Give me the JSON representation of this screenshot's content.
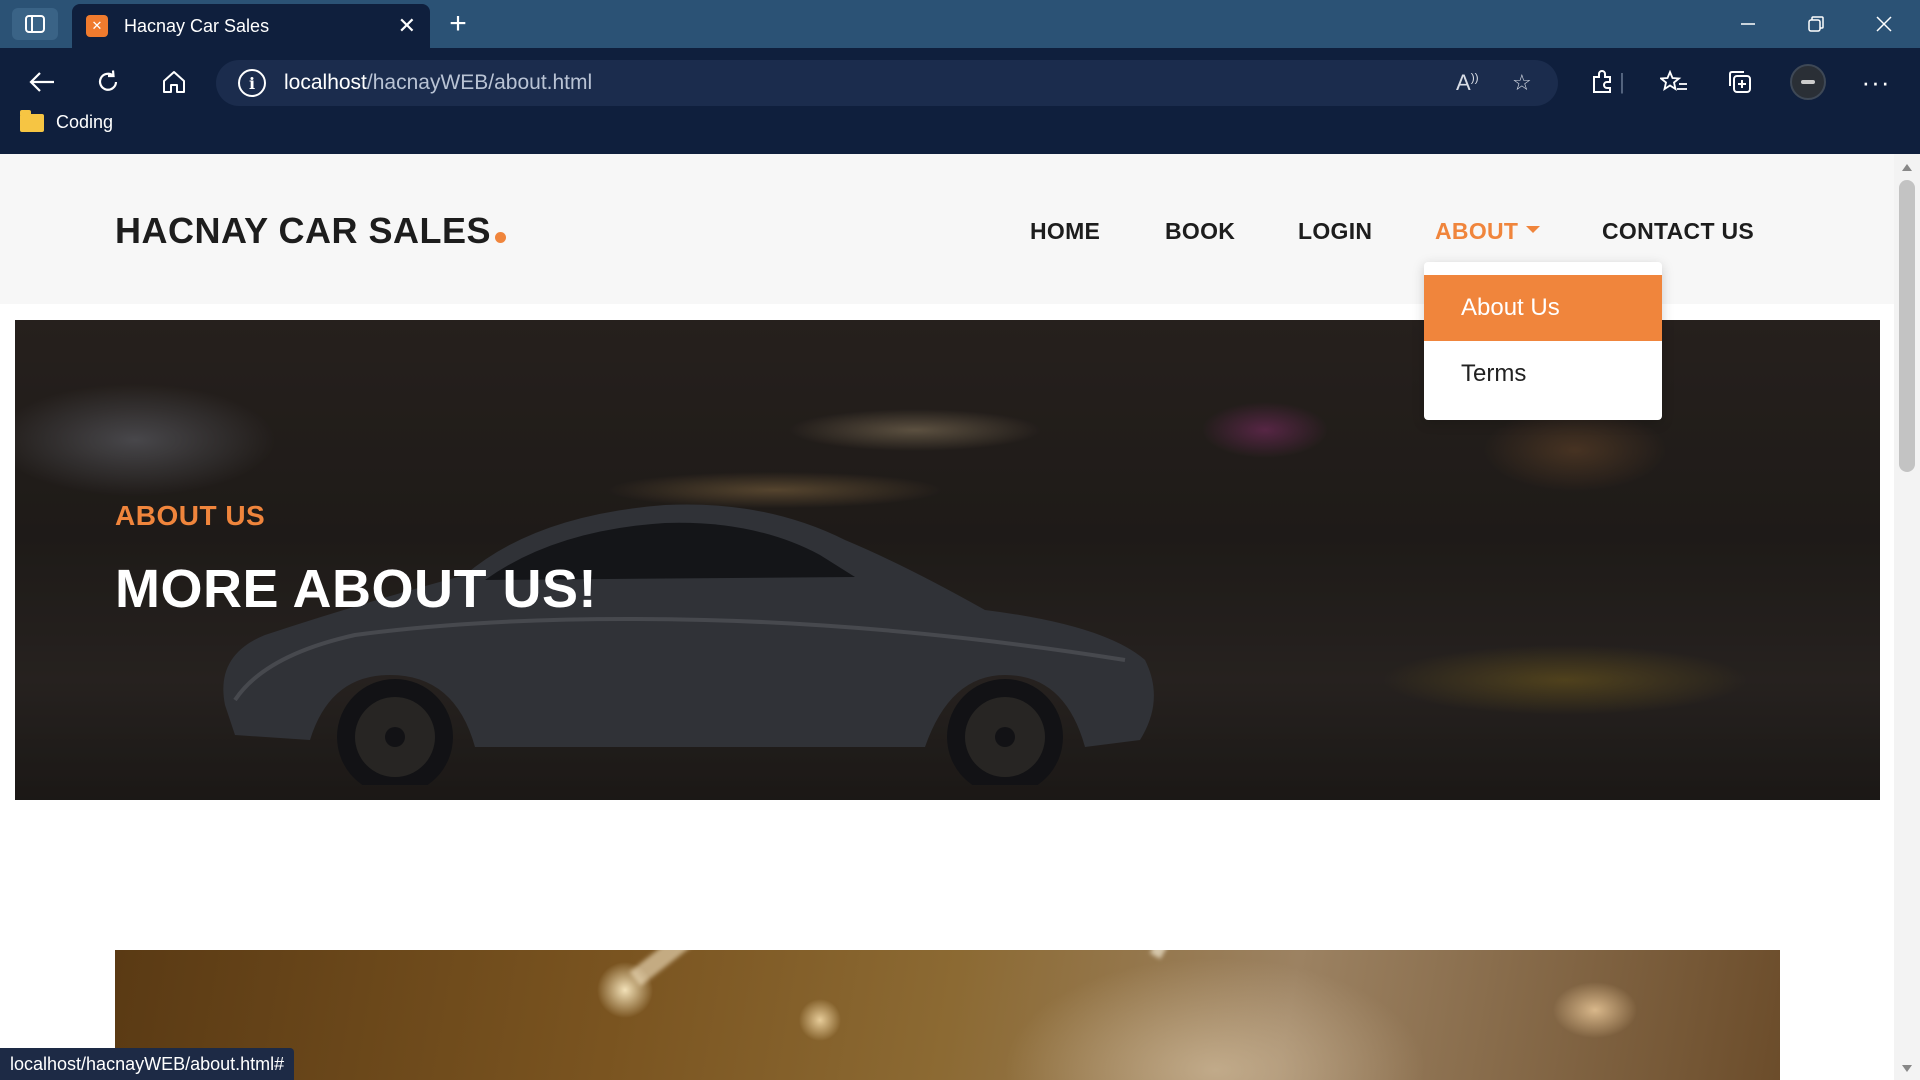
{
  "browser": {
    "tab": {
      "favicon": "XAMPP",
      "title": "Hacnay Car Sales"
    },
    "address": {
      "host": "localhost",
      "path": "/hacnayWEB/about.html"
    },
    "bookmarks": [
      {
        "label": "Coding"
      }
    ],
    "status_url": "localhost/hacnayWEB/about.html#"
  },
  "site": {
    "brand": "HACNAY CAR SALES",
    "nav": [
      {
        "label": "HOME"
      },
      {
        "label": "BOOK"
      },
      {
        "label": "LOGIN"
      },
      {
        "label": "ABOUT"
      },
      {
        "label": "CONTACT US"
      }
    ],
    "dropdown": [
      {
        "label": "About Us",
        "active": true
      },
      {
        "label": "Terms",
        "active": false
      }
    ],
    "hero": {
      "subtitle": "ABOUT US",
      "title": "MORE ABOUT US!"
    }
  },
  "colors": {
    "accent": "#f0853c",
    "chrome_dark": "#0f1f3d",
    "tabbar": "#2b5275"
  }
}
